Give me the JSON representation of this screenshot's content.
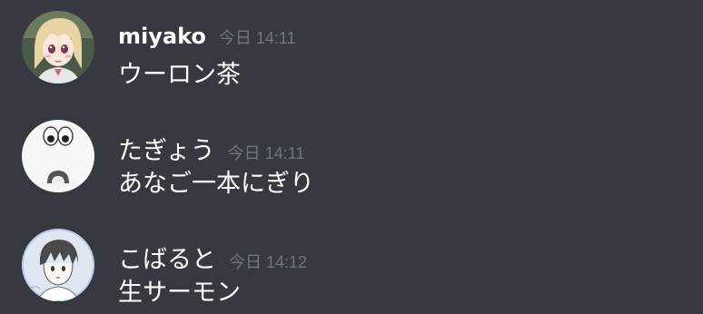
{
  "messages": [
    {
      "username": "miyako",
      "timestamp": "今日 14:11",
      "content": "ウーロン茶",
      "avatar_icon": "anime-girl-avatar-icon"
    },
    {
      "username": "たぎょう",
      "timestamp": "今日 14:11",
      "content": "あなご一本にぎり",
      "avatar_icon": "surprised-face-avatar-icon"
    },
    {
      "username": "こばると",
      "timestamp": "今日 14:12",
      "content": "生サーモン",
      "avatar_icon": "sketch-boy-avatar-icon"
    }
  ],
  "colors": {
    "background": "#36393f",
    "username": "#ffffff",
    "timestamp": "#72767d",
    "text": "#ffffff"
  }
}
